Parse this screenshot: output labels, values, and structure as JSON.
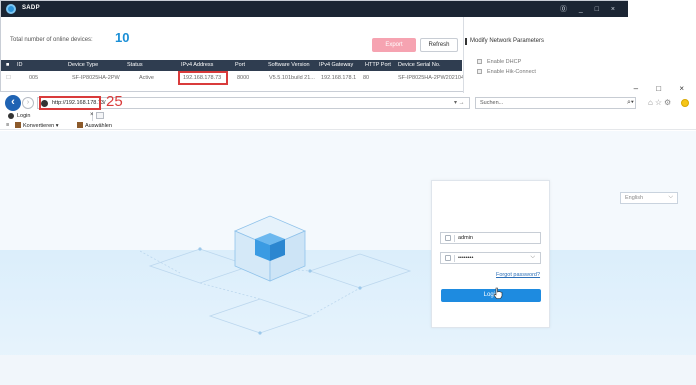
{
  "sadp": {
    "title": "SADP",
    "window_controls": "⓪ _ □ ×",
    "total_label": "Total number of online devices:",
    "total_count": "10",
    "export_label": "Export",
    "refresh_label": "Refresh",
    "table": {
      "headers": [
        "ID",
        "Device Type",
        "Status",
        "IPv4 Address",
        "Port",
        "Software Version",
        "IPv4 Gateway",
        "HTTP Port",
        "Device Serial No."
      ],
      "row": [
        "005",
        "SF-IP8025HA-2PW",
        "Active",
        "192.168.178.73",
        "8000",
        "V5.5.101build 21...",
        "192.168.178.1",
        "80",
        "SF-IP8025HA-2PW20210410"
      ]
    },
    "modify_panel": {
      "title": "Modify Network Parameters",
      "enable_dhcp": "Enable DHCP",
      "enable_hik_connect": "Enable Hik-Connect"
    }
  },
  "browser": {
    "address": "http://192.168.178.73/",
    "annotation": "25",
    "search_placeholder": "Suchen...",
    "tab_label": "Login",
    "favorites": [
      "Konvertieren",
      "Auswählen"
    ],
    "window_controls": "– □ ×"
  },
  "login_page": {
    "language": "English",
    "username": "admin",
    "password_mask": "••••••••",
    "forgot_password": "Forgot password?",
    "login_label": "Login"
  },
  "colors": {
    "sadp_title_bar": "#1b2533",
    "accent_blue": "#1e8be0",
    "highlight_red": "#d93b3b",
    "export_pink": "#f6a3b1"
  }
}
